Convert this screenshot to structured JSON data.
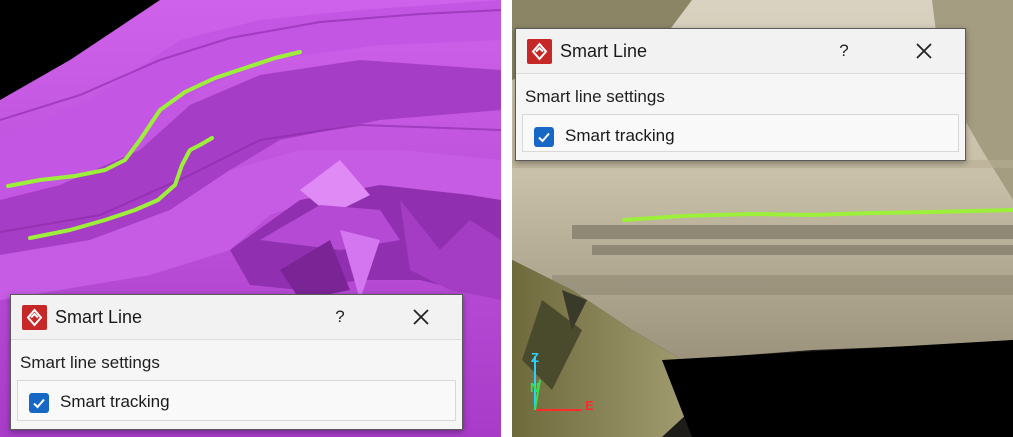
{
  "colors": {
    "terrain_magenta": "#b847d9",
    "smart_line_green": "#9cf03a",
    "checkbox_blue": "#1767c4",
    "app_icon_red": "#c62828"
  },
  "left_panel": {
    "viewport_icon": "magenta-terrain-mesh",
    "dialog": {
      "title": "Smart Line",
      "app_icon": "smart-line-app-icon",
      "help_label": "?",
      "close_icon": "close-icon",
      "section_label": "Smart line settings",
      "checkbox_label": "Smart tracking",
      "checkbox_checked": true
    }
  },
  "right_panel": {
    "viewport_icon": "textured-quarry-pointcloud",
    "axis_labels": {
      "z": "Z",
      "n": "N",
      "e": "E"
    },
    "dialog": {
      "title": "Smart Line",
      "app_icon": "smart-line-app-icon",
      "help_label": "?",
      "close_icon": "close-icon",
      "section_label": "Smart line settings",
      "checkbox_label": "Smart tracking",
      "checkbox_checked": true
    }
  }
}
